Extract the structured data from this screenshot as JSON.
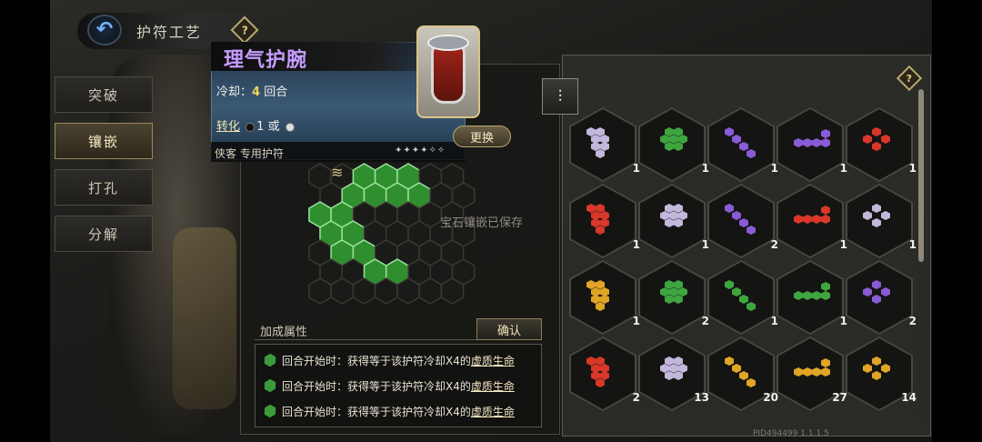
{
  "header": {
    "title": "护符工艺",
    "back_icon": "back-arrow-icon",
    "help_symbol": "?"
  },
  "tabs": [
    {
      "label": "突破",
      "active": false
    },
    {
      "label": "镶嵌",
      "active": true
    },
    {
      "label": "打孔",
      "active": false
    },
    {
      "label": "分解",
      "active": false
    }
  ],
  "item": {
    "name": "理气护腕",
    "cooldown_label": "冷却：",
    "cooldown_value": "4",
    "cooldown_unit": "回合",
    "convert_label": "转化",
    "convert_mid": "1",
    "convert_or": "或",
    "owner": "侠客 专用护符",
    "swap_label": "更换",
    "stars": "✦✦✦✦✧✧"
  },
  "board": {
    "saved_note": "宝石镶嵌已保存"
  },
  "bonus": {
    "title": "加成属性",
    "confirm_label": "确认",
    "rows": [
      {
        "prefix": "回合开始时：获得等于该护符冷却X4的",
        "link": "虚质生命"
      },
      {
        "prefix": "回合开始时：获得等于该护符冷却X4的",
        "link": "虚质生命"
      },
      {
        "prefix": "回合开始时：获得等于该护符冷却X4的",
        "link": "虚质生命"
      }
    ]
  },
  "gem_inventory": {
    "help_symbol": "?",
    "filter_icon": "filter-icon",
    "cells": [
      {
        "color": "#c3b7dc",
        "count": "1"
      },
      {
        "color": "#3fa63f",
        "count": "1"
      },
      {
        "color": "#8a5bd8",
        "count": "1"
      },
      {
        "color": "#8a5bd8",
        "count": "1"
      },
      {
        "color": "#d8372a",
        "count": "1"
      },
      {
        "color": "#d8372a",
        "count": "1"
      },
      {
        "color": "#c3b7dc",
        "count": "1"
      },
      {
        "color": "#8a5bd8",
        "count": "2"
      },
      {
        "color": "#d8372a",
        "count": "1"
      },
      {
        "color": "#c3b7dc",
        "count": "1"
      },
      {
        "color": "#e0a526",
        "count": "1"
      },
      {
        "color": "#3fa63f",
        "count": "2"
      },
      {
        "color": "#3fa63f",
        "count": "1"
      },
      {
        "color": "#3fa63f",
        "count": "1"
      },
      {
        "color": "#8a5bd8",
        "count": "2"
      },
      {
        "color": "#d8372a",
        "count": "2"
      },
      {
        "color": "#c3b7dc",
        "count": "13"
      },
      {
        "color": "#e0a526",
        "count": "20"
      },
      {
        "color": "#e0a526",
        "count": "27"
      },
      {
        "color": "#e0a526",
        "count": "14"
      }
    ]
  },
  "footer": {
    "pid": "PID494499  1.1.1.5"
  }
}
